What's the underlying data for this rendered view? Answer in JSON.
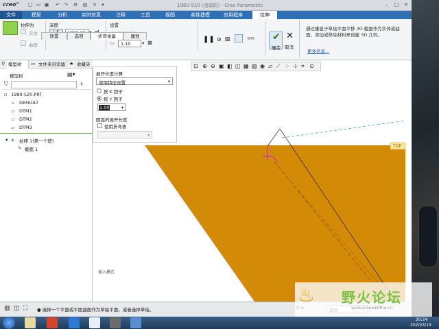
{
  "window": {
    "brand": "creo°",
    "title": "1980-520 (活动的) - Creo Parametric"
  },
  "menu": {
    "items": [
      "文件",
      "模型",
      "分析",
      "实时仿真",
      "注释",
      "工具",
      "视图",
      "柔性建模",
      "应用程序",
      "拉伸"
    ]
  },
  "ribbon": {
    "group_extrude_as": "拉伸为",
    "solid_label": "实体",
    "surface_label": "曲面",
    "depth_label": "深度",
    "depth_value": "1980.00",
    "settings_label": "设置",
    "remove_material": "移除材料",
    "thickness_value": "1.10",
    "subtabs": [
      "放置",
      "选项",
      "折弯余量",
      "属性"
    ],
    "ok_label": "确定",
    "cancel_label": "取消",
    "help_text": "通过垂直于草绘平面平移 2D 截面作为实体或曲面，添加或移除材料来创建 3D 几何。",
    "help_link": "更多信息..."
  },
  "leftpanel": {
    "tabs": [
      "模型树",
      "文件夹浏览器",
      "收藏夹"
    ],
    "model_tree_label": "模型树",
    "items": [
      "1980-520.PRT",
      "DEFAULT",
      "DTM1",
      "DTM2",
      "DTM3"
    ],
    "feature": "拉伸 1(第一个壁)",
    "sketch": "截面 1"
  },
  "popup": {
    "title": "展开长度计算",
    "dropdown_value": "使用特征设置",
    "option_k": "按 K 因子",
    "option_y": "按 Y 因子",
    "y_value": "1.00",
    "section2": "圆弧的展开长度",
    "use_table": "使用折弯表"
  },
  "graphics": {
    "plane_label": "TOP",
    "insert_mode": "插入模式"
  },
  "statusbar": {
    "message": "● 选择一个平面或平面曲面作为草绘平面，或者选择草绘。",
    "filter": "草绘"
  },
  "taskbar": {
    "time": "20:24",
    "date": "2020/3/19"
  },
  "watermark": {
    "text": "野火论坛",
    "url": "www.proewildfire.cn"
  },
  "colors": {
    "menubar": "#2f6fb3",
    "sheet": "#d28a07",
    "accent_magenta": "#cc33aa"
  }
}
